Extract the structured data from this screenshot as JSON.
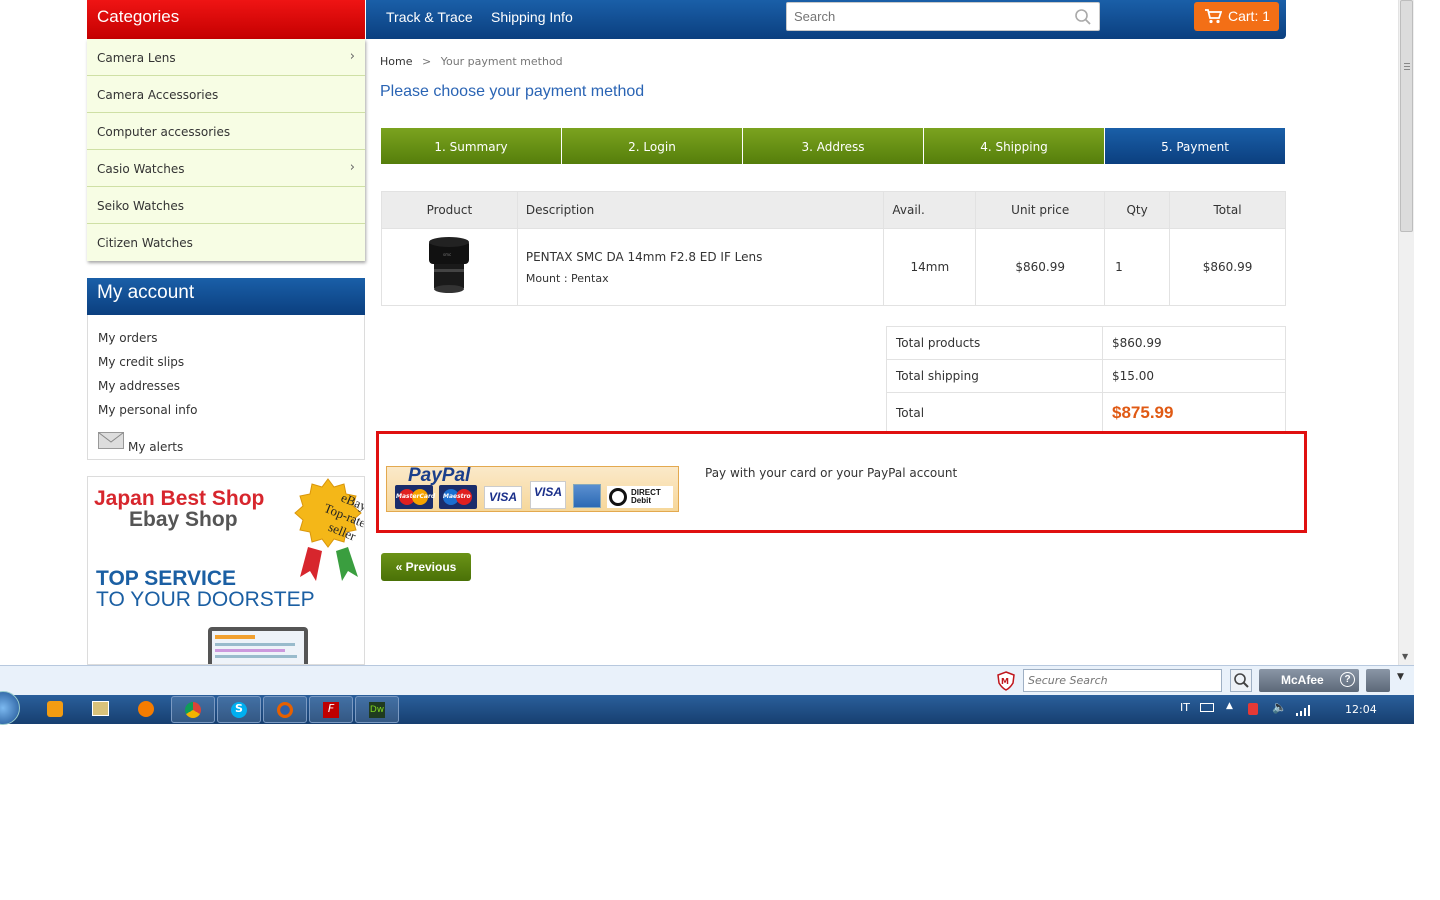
{
  "header": {
    "categories_title": "Categories",
    "nav": [
      "Track & Trace",
      "Shipping Info"
    ],
    "search_placeholder": "Search",
    "cart_label": "Cart: 1"
  },
  "categories": [
    {
      "label": "Camera Lens",
      "has_submenu": true
    },
    {
      "label": "Camera Accessories",
      "has_submenu": false
    },
    {
      "label": "Computer accessories",
      "has_submenu": false
    },
    {
      "label": "Casio Watches",
      "has_submenu": true
    },
    {
      "label": "Seiko Watches",
      "has_submenu": false
    },
    {
      "label": "Citizen Watches",
      "has_submenu": false
    }
  ],
  "account": {
    "title": "My account",
    "links": [
      "My orders",
      "My credit slips",
      "My addresses",
      "My personal info",
      "My alerts"
    ]
  },
  "ad": {
    "line1": "Japan Best Shop",
    "line2": "Ebay Shop",
    "seal": [
      "eBay",
      "Top-rated",
      "seller"
    ],
    "tag1": "TOP SERVICE",
    "tag2": "TO YOUR DOORSTEP"
  },
  "breadcrumb": {
    "home": "Home",
    "sep": ">",
    "current": "Your payment method"
  },
  "page_title": "Please choose your payment method",
  "steps": [
    {
      "label": "1. Summary",
      "active": false
    },
    {
      "label": "2. Login",
      "active": false
    },
    {
      "label": "3. Address",
      "active": false
    },
    {
      "label": "4. Shipping",
      "active": false
    },
    {
      "label": "5. Payment",
      "active": true
    }
  ],
  "cart": {
    "headers": [
      "Product",
      "Description",
      "Avail.",
      "Unit price",
      "Qty",
      "Total"
    ],
    "item": {
      "name": "PENTAX SMC DA 14mm F2.8 ED IF Lens",
      "attr": "Mount : Pentax",
      "avail": "14mm",
      "unit_price": "$860.99",
      "qty": "1",
      "total": "$860.99"
    }
  },
  "totals": {
    "products_label": "Total products",
    "products_value": "$860.99",
    "shipping_label": "Total shipping",
    "shipping_value": "$15.00",
    "total_label": "Total",
    "total_value": "$875.99"
  },
  "payment": {
    "paypal_logo": "PayPal",
    "cards": [
      "MasterCard",
      "Maestro",
      "VISA",
      "VISA",
      "DIRECT Debit"
    ],
    "description": "Pay with your card or your PayPal account"
  },
  "previous_label": "« Previous",
  "mcafee": {
    "search_placeholder": "Secure Search",
    "brand": "McAfee"
  },
  "taskbar": {
    "lang": "IT",
    "time": "12:04"
  },
  "colors": {
    "brand_blue": "#0b3f7f",
    "brand_red": "#c40000",
    "step_green": "#557e0b",
    "accent_orange": "#f36f16",
    "total_orange": "#e05a14"
  }
}
